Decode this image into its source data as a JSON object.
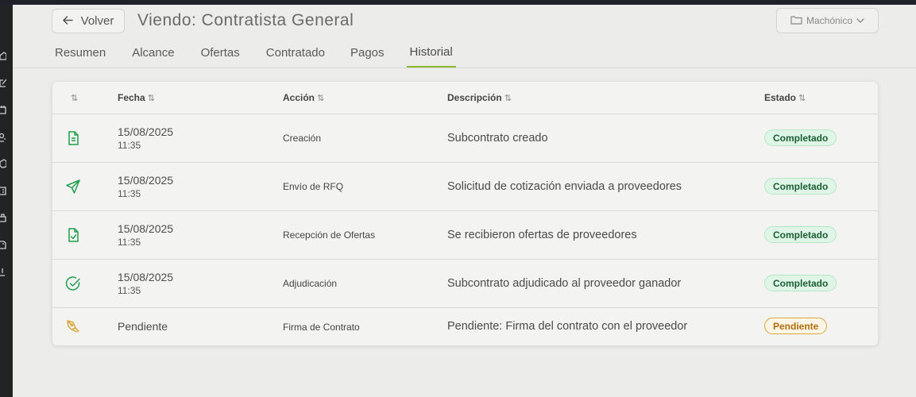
{
  "header": {
    "back_label": "Volver",
    "title": "Viendo: Contratista General",
    "project": "Machónico"
  },
  "tabs": [
    {
      "label": "Resumen"
    },
    {
      "label": "Alcance"
    },
    {
      "label": "Ofertas"
    },
    {
      "label": "Contratado"
    },
    {
      "label": "Pagos"
    },
    {
      "label": "Historial",
      "active": true
    }
  ],
  "table": {
    "sort_glyph": "⇅",
    "columns": [
      "Fecha",
      "Acción",
      "Descripción",
      "Estado"
    ],
    "rows": [
      {
        "icon": "document-icon",
        "date": "15/08/2025",
        "time": "11:35",
        "action": "Creación",
        "description": "Subcontrato creado",
        "status": "Completado"
      },
      {
        "icon": "send-icon",
        "date": "15/08/2025",
        "time": "11:35",
        "action": "Envío de RFQ",
        "description": "Solicitud de cotización enviada a proveedores",
        "status": "Completado"
      },
      {
        "icon": "document-check-icon",
        "date": "15/08/2025",
        "time": "11:35",
        "action": "Recepción de Ofertas",
        "description": "Se recibieron ofertas de proveedores",
        "status": "Completado"
      },
      {
        "icon": "check-circle-icon",
        "date": "15/08/2025",
        "time": "11:35",
        "action": "Adjudicación",
        "description": "Subcontrato adjudicado al proveedor ganador",
        "status": "Completado"
      },
      {
        "icon": "signature-pen-icon",
        "date": "Pendiente",
        "time": "",
        "action": "Firma de Contrato",
        "description": "Pendiente: Firma del contrato con el proveedor",
        "status": "Pendiente"
      }
    ]
  },
  "colors": {
    "accent": "#8db82f",
    "success": "#1e9e4f",
    "pending": "#d9a63a"
  }
}
